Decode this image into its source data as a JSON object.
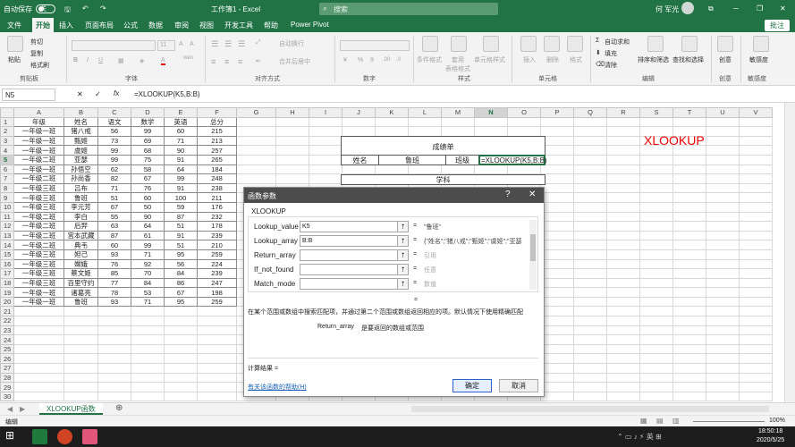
{
  "title_bar": {
    "autosave_label": "自动保存",
    "autosave_state": "关",
    "file_name": "工作簿1 - Excel",
    "search_placeholder": "搜索",
    "user": "何 军光",
    "accent": "#217346"
  },
  "ribbon_tabs": [
    "文件",
    "开始",
    "插入",
    "页面布局",
    "公式",
    "数据",
    "审阅",
    "视图",
    "开发工具",
    "帮助",
    "Power Pivot"
  ],
  "active_tab": "开始",
  "share_label": "批注",
  "ribbon": {
    "clipboard": {
      "paste": "粘贴",
      "cut": "剪切",
      "copy": "复制",
      "format_painter": "格式刷",
      "group": "剪贴板"
    },
    "font": {
      "bold": "B",
      "italic": "I",
      "underline": "U",
      "group": "字体",
      "font_size": "11",
      "grow": "A",
      "shrink": "A",
      "wen": "wén",
      "color_a": "A"
    },
    "alignment": {
      "wrap": "自动换行",
      "merge": "合并后居中",
      "group": "对齐方式"
    },
    "number": {
      "format": "常规",
      "pct": "%",
      "comma": "9",
      "group": "数字",
      "dec_inc": ".00",
      "dec_dec": ".0"
    },
    "styles": {
      "cond": "条件格式",
      "table": "套用\n表格格式",
      "cell": "单元格样式",
      "group": "样式"
    },
    "cells": {
      "insert": "插入",
      "delete": "删除",
      "format": "格式",
      "group": "单元格"
    },
    "editing": {
      "autosum": "自动求和",
      "fill": "填充",
      "clear": "清除",
      "sort": "排序和筛选",
      "find": "查找和选择",
      "group": "编辑"
    },
    "ideas": {
      "label": "创意",
      "group": "创意"
    },
    "sensitivity": {
      "label": "敏感度",
      "group": "敏感度"
    }
  },
  "formula_bar": {
    "name_box": "N5",
    "cancel": "✕",
    "enter": "✓",
    "fx": "fx",
    "formula": "=XLOOKUP(K5,B:B)"
  },
  "columns": [
    "A",
    "B",
    "C",
    "D",
    "E",
    "F",
    "G",
    "H",
    "I",
    "J",
    "K",
    "L",
    "M",
    "N",
    "O",
    "P",
    "Q",
    "R",
    "S",
    "T",
    "U",
    "V"
  ],
  "rows": [
    [
      "年级",
      "姓名",
      "语文",
      "数学",
      "英语",
      "总分"
    ],
    [
      "一年级一班",
      "猪八戒",
      "56",
      "99",
      "60",
      "215"
    ],
    [
      "一年级一班",
      "甄姬",
      "73",
      "69",
      "71",
      "213"
    ],
    [
      "一年级一班",
      "虞姬",
      "99",
      "68",
      "90",
      "257"
    ],
    [
      "一年级二班",
      "亚瑟",
      "99",
      "75",
      "91",
      "265"
    ],
    [
      "一年级一班",
      "孙悟空",
      "62",
      "58",
      "64",
      "184"
    ],
    [
      "一年级二班",
      "孙尚香",
      "82",
      "67",
      "99",
      "248"
    ],
    [
      "一年级三班",
      "吕布",
      "71",
      "76",
      "91",
      "238"
    ],
    [
      "一年级三班",
      "鲁班",
      "51",
      "60",
      "100",
      "211"
    ],
    [
      "一年级三班",
      "李元芳",
      "67",
      "50",
      "59",
      "176"
    ],
    [
      "一年级二班",
      "李白",
      "55",
      "90",
      "87",
      "232"
    ],
    [
      "一年级二班",
      "后羿",
      "63",
      "64",
      "51",
      "178"
    ],
    [
      "一年级二班",
      "宫本武藏",
      "87",
      "61",
      "91",
      "239"
    ],
    [
      "一年级二班",
      "典韦",
      "60",
      "99",
      "51",
      "210"
    ],
    [
      "一年级三班",
      "妲己",
      "93",
      "71",
      "95",
      "259"
    ],
    [
      "一年级三班",
      "嫦娥",
      "76",
      "92",
      "56",
      "224"
    ],
    [
      "一年级三班",
      "蔡文姬",
      "85",
      "70",
      "84",
      "239"
    ],
    [
      "一年级三班",
      "百里守约",
      "77",
      "84",
      "86",
      "247"
    ],
    [
      "一年级一班",
      "诸葛亮",
      "78",
      "53",
      "67",
      "198"
    ],
    [
      "一年级一班",
      "鲁班",
      "93",
      "71",
      "95",
      "259"
    ]
  ],
  "report_card": {
    "title": "成绩单",
    "name_label": "姓名",
    "name_value": "鲁班",
    "class_label": "班级",
    "class_formula": "=XLOOKUP(K5,B:B)",
    "subject_label": "学科"
  },
  "xlookup_label": "XLOOKUP",
  "dialog": {
    "title": "函数参数",
    "help": "?",
    "close": "✕",
    "function_name": "XLOOKUP",
    "args": [
      {
        "name": "Lookup_value",
        "value": "K5",
        "result": "\"鲁班\""
      },
      {
        "name": "Lookup_array",
        "value": "B:B",
        "result": "{\"姓名\";\"猪八戒\";\"甄姬\";\"虞姬\";\"亚瑟"
      },
      {
        "name": "Return_array",
        "value": "",
        "result": "引用"
      },
      {
        "name": "If_not_found",
        "value": "",
        "result": "任意"
      },
      {
        "name": "Match_mode",
        "value": "",
        "result": "数值"
      }
    ],
    "eq": "=",
    "description": "在某个范围或数组中搜索匹配项，并通过第二个范围或数组返回相应的项。默认情况下使用精确匹配",
    "arg_help_name": "Return_array",
    "arg_help_text": "是要返回的数组或范围",
    "result_label": "计算结果 =",
    "help_link": "有关该函数的帮助(H)",
    "ok": "确定",
    "cancel": "取消"
  },
  "sheet_tab": "XLOOKUP函数",
  "status": "编辑",
  "zoom": "100%",
  "taskbar": {
    "time": "18:50:18",
    "date": "2020/5/25"
  }
}
